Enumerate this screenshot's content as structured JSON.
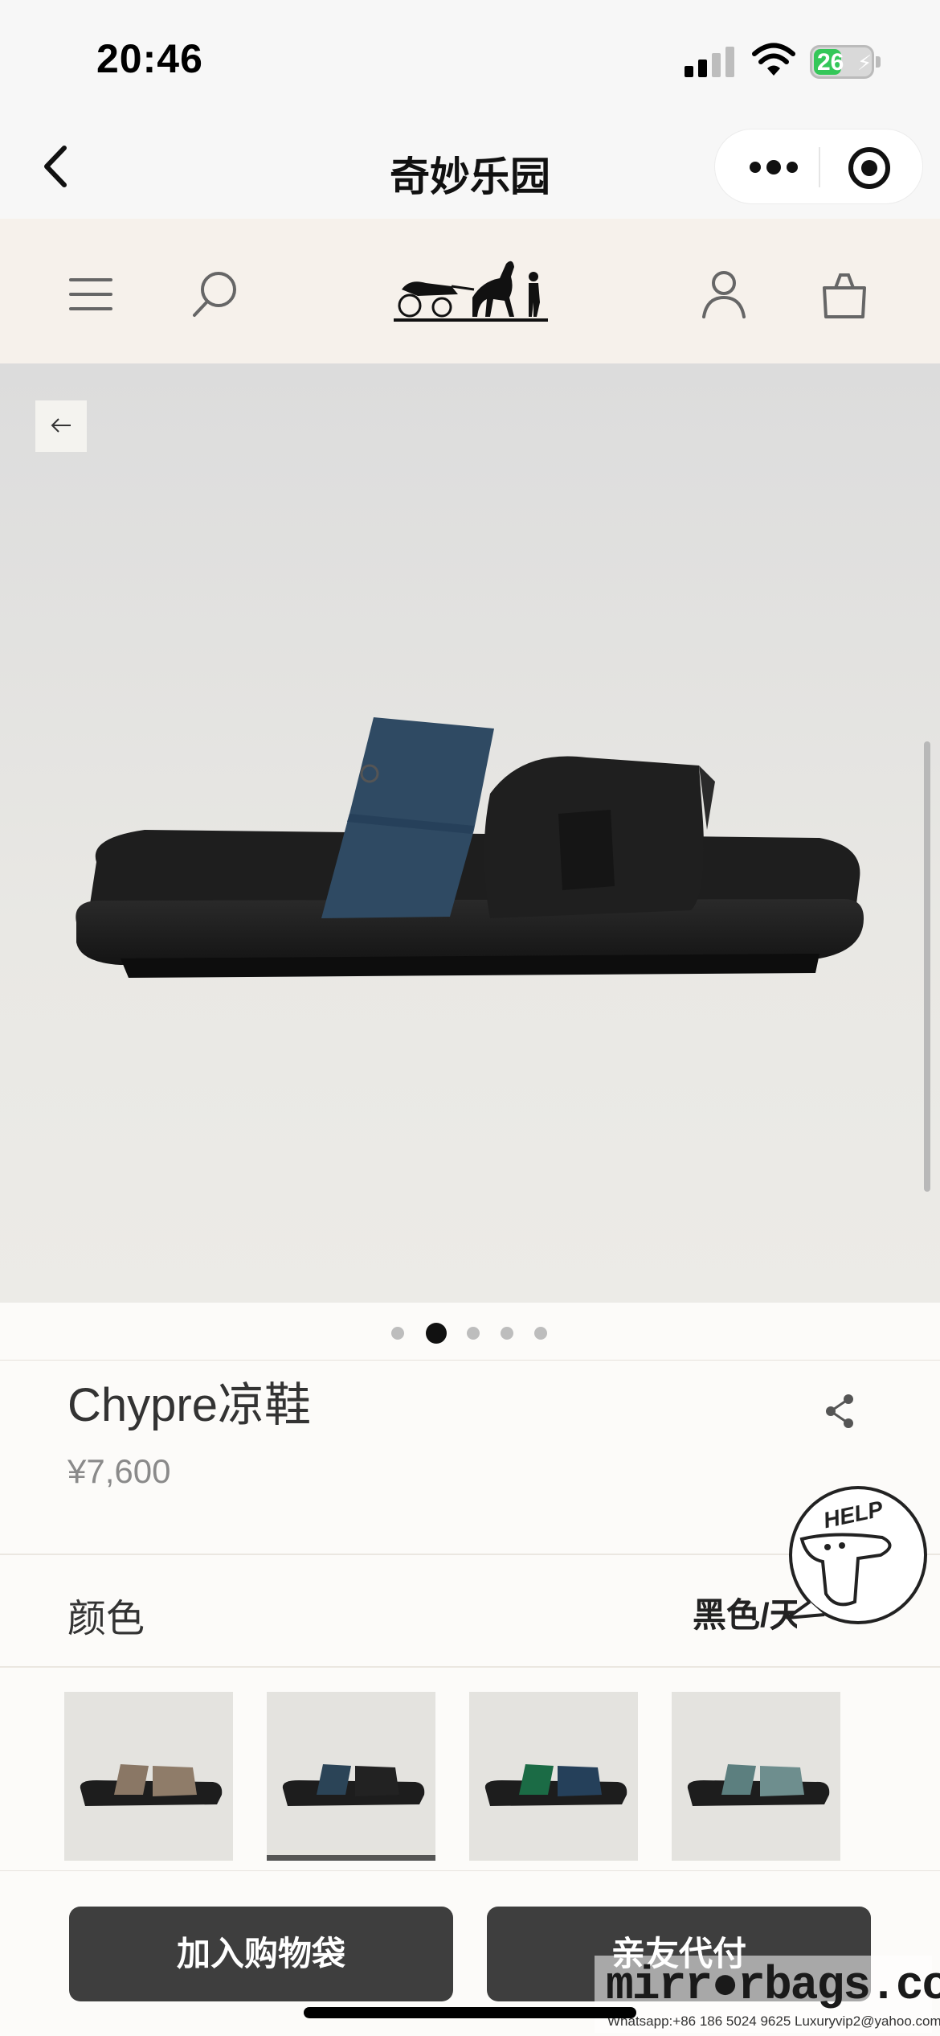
{
  "status_bar": {
    "time": "20:46",
    "battery": "26"
  },
  "mini_program": {
    "title": "奇妙乐园"
  },
  "product": {
    "name": "Chypre凉鞋",
    "price": "¥7,600",
    "image_count": 5,
    "active_image": 2,
    "main_colors": {
      "strap_front": "#2f4a63",
      "strap_back": "#1e1e1e",
      "sole": "#1b1b1b"
    }
  },
  "color_section": {
    "label": "颜色",
    "value": "黑色/天"
  },
  "swatches": [
    {
      "name": "taupe",
      "strap1": "#8a7765",
      "strap2": "#8f7c69",
      "selected": false
    },
    {
      "name": "navy",
      "strap1": "#2b4457",
      "strap2": "#222222",
      "selected": true
    },
    {
      "name": "green",
      "strap1": "#1b6b45",
      "strap2": "#25405a",
      "selected": false
    },
    {
      "name": "sage",
      "strap1": "#5c7f7f",
      "strap2": "#6e8e8e",
      "selected": false
    }
  ],
  "help_badge": {
    "text": "HELP"
  },
  "actions": {
    "add_to_bag": "加入购物袋",
    "friend_pay": "亲友代付"
  },
  "watermark": {
    "main": "mirr",
    "main2": "rbags.com",
    "sub": "Whatsapp:+86 186 5024 9625  Luxuryvip2@yahoo.com"
  }
}
